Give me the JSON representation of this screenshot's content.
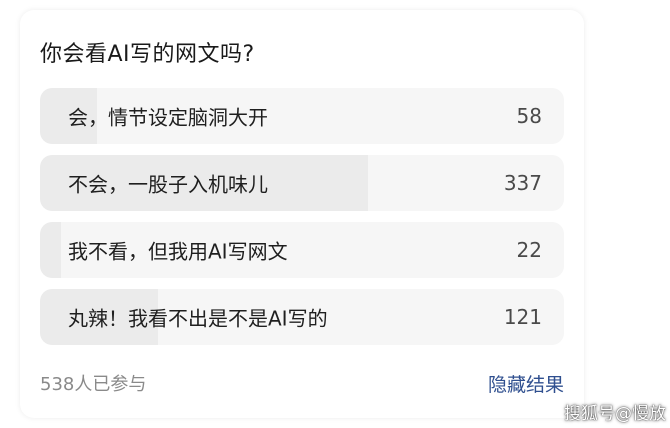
{
  "poll": {
    "question": "你会看AI写的网文吗?",
    "options": [
      {
        "label": "会，情节设定脑洞大开",
        "count": "58",
        "share": 0.108
      },
      {
        "label": "不会，一股子入机味儿",
        "count": "337",
        "share": 0.626
      },
      {
        "label": "我不看，但我用AI写网文",
        "count": "22",
        "share": 0.041
      },
      {
        "label": "丸辣！我看不出是不是AI写的",
        "count": "121",
        "share": 0.225
      }
    ],
    "participants": "538人已参与",
    "hide_results": "隐藏结果"
  },
  "watermark": "搜狐号@慢放",
  "colors": {
    "option_bg": "#f6f6f6",
    "option_fill": "#ebebeb",
    "link": "#2f4f8f"
  }
}
